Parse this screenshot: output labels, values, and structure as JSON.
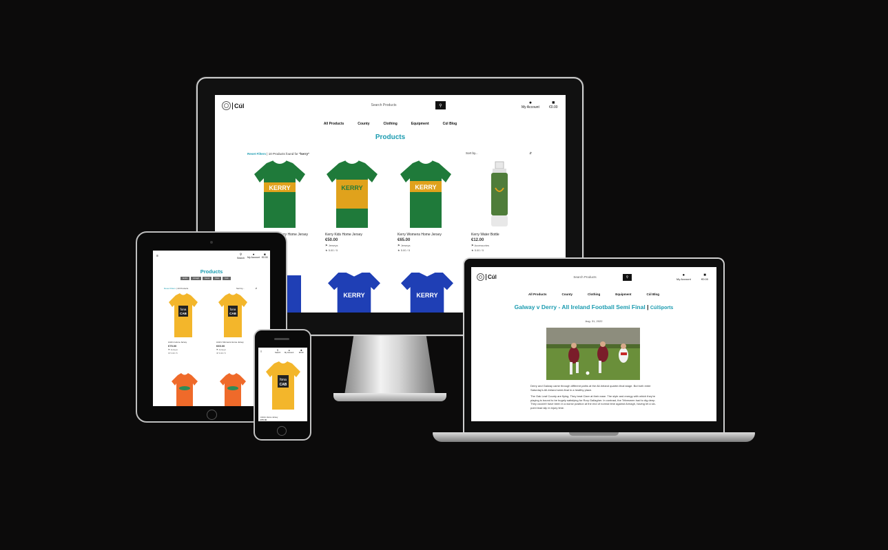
{
  "desktop": {
    "logo_text": "Cúl",
    "search_placeholder": "Search Products",
    "account_label": "My Account",
    "bag_total": "€0.00",
    "nav": [
      "All Products",
      "County",
      "Clothing",
      "Equipment",
      "Cúl Blog"
    ],
    "page_title": "Products",
    "reset_filters": "Reset Filters",
    "result_text": "| 10 Products found for",
    "result_query": "\"kerry\"",
    "sort_label": "Sort by...",
    "products": [
      {
        "name": "Kerry Home Jersey",
        "price": "",
        "category": "",
        "rating": ""
      },
      {
        "name": "Kerry Kids Home Jersey",
        "price": "€50.00",
        "category": "Jerseys",
        "rating": "5.00 / 5"
      },
      {
        "name": "Kerry Womens Home Jersey",
        "price": "€65.00",
        "category": "Jerseys",
        "rating": "5.00 / 5"
      },
      {
        "name": "Kerry Water Bottle",
        "price": "€12.00",
        "category": "Accessories",
        "rating": "5.00 / 5"
      }
    ],
    "row2_text": "KERRY"
  },
  "laptop": {
    "logo_text": "Cúl",
    "search_placeholder": "Search Products",
    "account_label": "My Account",
    "bag_total": "€0.00",
    "nav": [
      "All Products",
      "County",
      "Clothing",
      "Equipment",
      "Cúl Blog"
    ],
    "post_title": "Galway v Derry - All Ireland Football Semi Final",
    "post_author": "CúlSports",
    "post_date": "Aug. 31, 2022",
    "paragraphs": [
      "Derry and Galway came through different paths at the All-Ireland quarter-final stage. But both enter Saturday's All-Ireland semi-final in a healthy place.",
      "The Oak Leaf County are flying. They beat Clare at their ease. The style and energy with which they're playing is bound to be hugely satisfying for Rory Gallagher. In contrast, the Tribesmen had to dig deep. They couldn't have been in a worse position at the end of normal time against Armagh, having let a six-point lead slip in injury time."
    ]
  },
  "tablet": {
    "search_label": "Search",
    "account_label": "My Account",
    "bag_total": "€0.00",
    "page_title": "Products",
    "chips": [
      "Antrim",
      "Armagh",
      "Cavan",
      "Clare",
      "Cork"
    ],
    "reset_filters": "Reset Filters",
    "result_text": "| 10 Products",
    "sort_label": "Sort by...",
    "products": [
      {
        "name": "Antrim Home Jersey",
        "price": "€75.00",
        "category": "Jerseys",
        "rating": "5.00 / 5"
      },
      {
        "name": "Antrim Womens Home Jersey",
        "price": "€65.00",
        "category": "Jerseys",
        "rating": "5.00 / 5"
      }
    ]
  },
  "phone": {
    "search_label": "Search",
    "account_label": "My Account",
    "bag_total": "€0.00",
    "product_name": "Antrim Home Jersey",
    "product_price": "€75.00"
  },
  "colors": {
    "accent": "#1a9bb0",
    "kerry_green": "#1f7a3a",
    "kerry_gold": "#e0a21c",
    "antrim_yellow": "#f3b62b",
    "armagh_orange": "#ef6a2a",
    "blue_jersey": "#1f3fb5"
  }
}
